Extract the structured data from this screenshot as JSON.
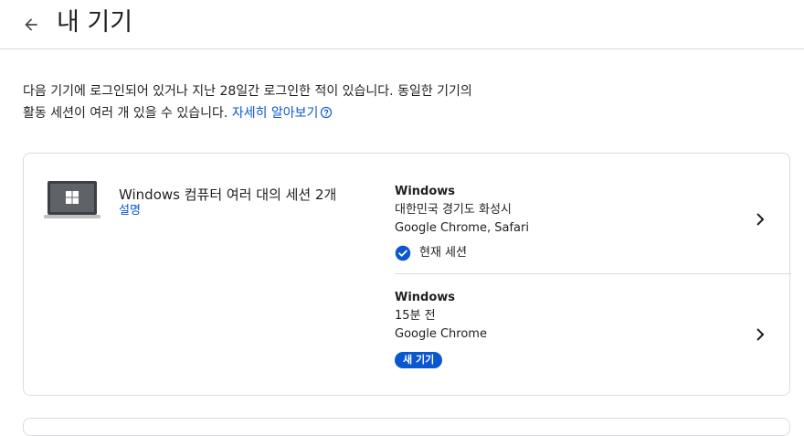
{
  "header": {
    "title": "내 기기",
    "back_icon": "arrow-back-icon"
  },
  "description": {
    "line1": "다음 기기에 로그인되어 있거나 지난 28일간 로그인한 적이 있습니다. 동일한 기기의",
    "line2": "활동 세션이 여러 개 있을 수 있습니다. ",
    "learn_more": "자세히 알아보기"
  },
  "device_group": {
    "title": "Windows 컴퓨터 여러 대의 세션 2개",
    "link": "설명",
    "icon": "windows-laptop-icon"
  },
  "sessions": [
    {
      "os": "Windows",
      "location": "대한민국 경기도 화성시",
      "browsers": "Google Chrome, Safari",
      "status": "현재 세션"
    },
    {
      "os": "Windows",
      "time": "15분 전",
      "browsers": "Google Chrome",
      "badge": "새 기기"
    }
  ],
  "colors": {
    "accent": "#0b57d0",
    "border": "#dadce0",
    "text": "#1f1f1f"
  }
}
